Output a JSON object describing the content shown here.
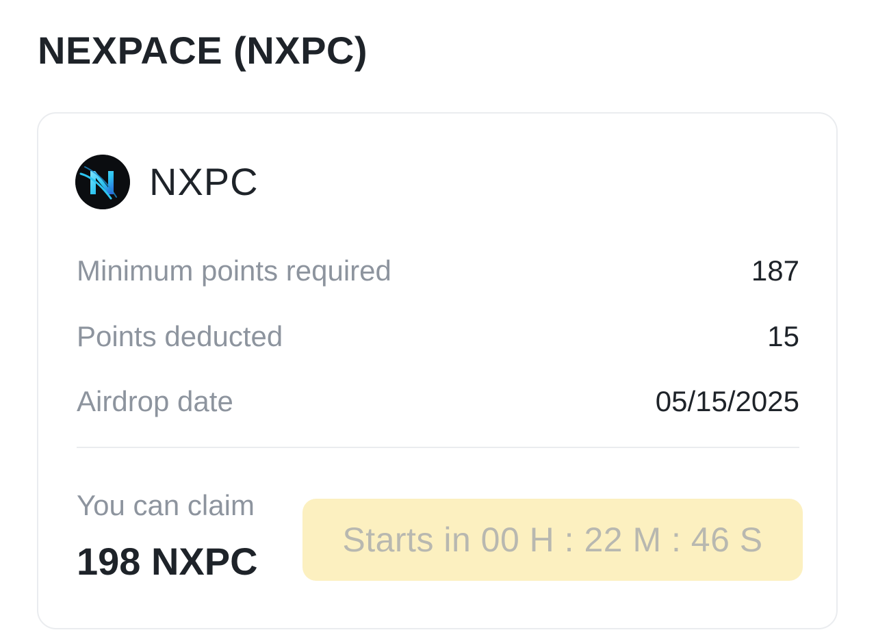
{
  "page": {
    "title": "NEXPACE (NXPC)"
  },
  "token": {
    "name": "NXPC",
    "logo_icon": "nxpc-logo-icon"
  },
  "details": [
    {
      "label": "Minimum points required",
      "value": "187"
    },
    {
      "label": "Points deducted",
      "value": "15"
    },
    {
      "label": "Airdrop date",
      "value": "05/15/2025"
    }
  ],
  "claim": {
    "label": "You can claim",
    "amount": "198 NXPC",
    "button_label": "Starts in 00 H : 22 M : 46 S",
    "button_state": "disabled"
  },
  "colors": {
    "text_primary": "#1e2329",
    "text_secondary": "#8d949e",
    "button_bg": "#fcf0c0",
    "button_text_disabled": "#b8b8b0",
    "card_border": "#eaecef",
    "logo_accent": "#2ec5f0"
  }
}
